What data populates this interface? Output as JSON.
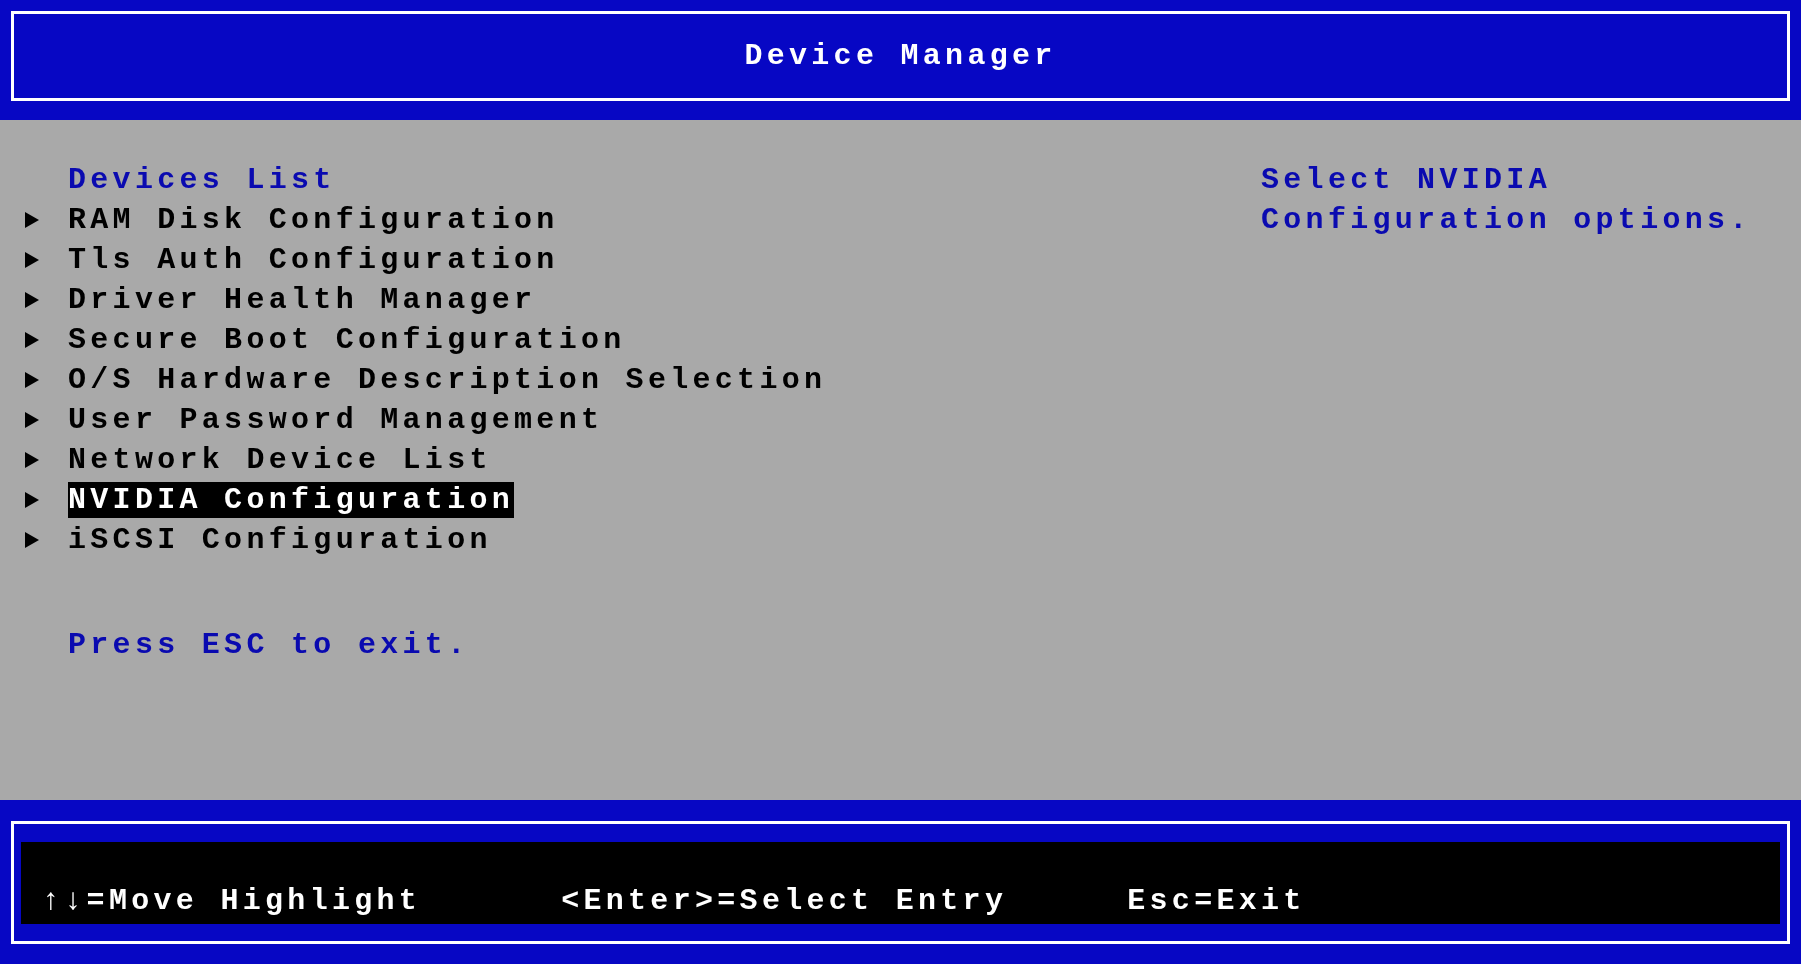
{
  "header": {
    "title": "Device Manager"
  },
  "menu": {
    "heading": "Devices List",
    "items": [
      {
        "label": "RAM Disk Configuration",
        "selected": false
      },
      {
        "label": "Tls Auth Configuration",
        "selected": false
      },
      {
        "label": "Driver Health Manager",
        "selected": false
      },
      {
        "label": "Secure Boot Configuration",
        "selected": false
      },
      {
        "label": "O/S Hardware Description Selection",
        "selected": false
      },
      {
        "label": "User Password Management",
        "selected": false
      },
      {
        "label": "Network Device List",
        "selected": false
      },
      {
        "label": "NVIDIA Configuration",
        "selected": true
      },
      {
        "label": "iSCSI Configuration",
        "selected": false
      }
    ],
    "note": "Press ESC to exit."
  },
  "help": {
    "text": "Select NVIDIA Configuration options."
  },
  "key_hints": [
    "↑↓=Move Highlight",
    "<Enter>=Select Entry",
    "Esc=Exit"
  ]
}
